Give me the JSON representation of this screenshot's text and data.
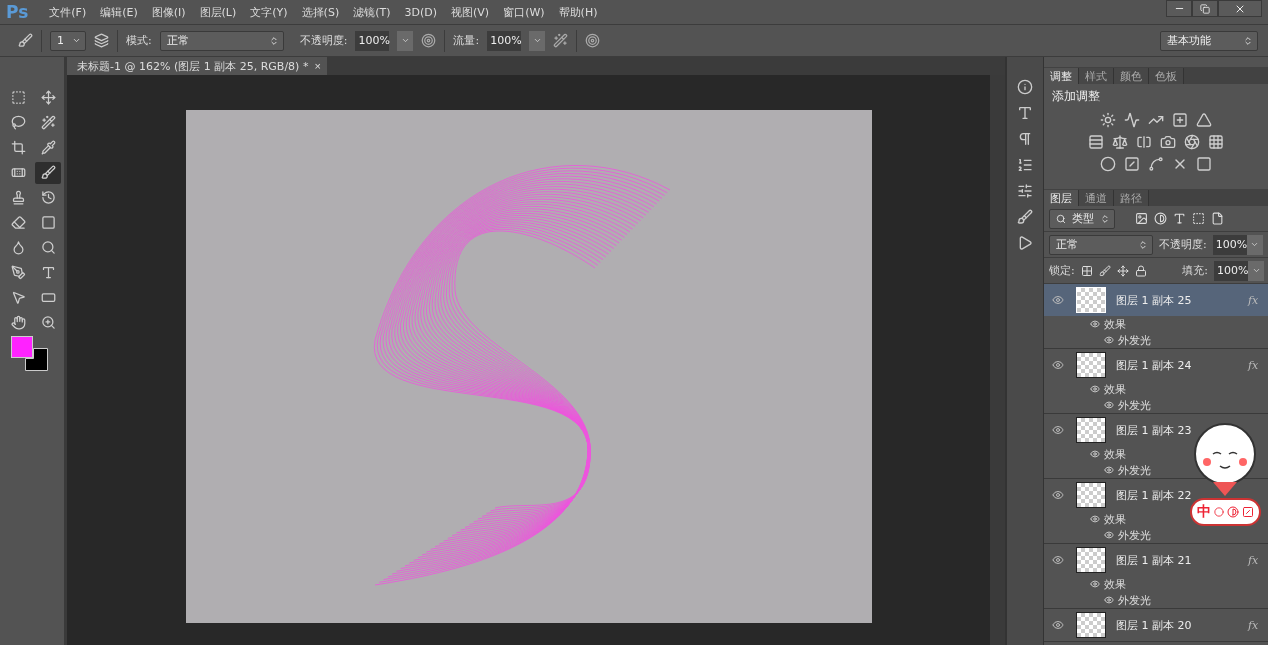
{
  "app": {
    "logo": "Ps"
  },
  "menu": [
    "文件(F)",
    "编辑(E)",
    "图像(I)",
    "图层(L)",
    "文字(Y)",
    "选择(S)",
    "滤镜(T)",
    "3D(D)",
    "视图(V)",
    "窗口(W)",
    "帮助(H)"
  ],
  "options": {
    "brush_size": "1",
    "mode_label": "模式:",
    "mode": "正常",
    "opacity_label": "不透明度:",
    "opacity": "100%",
    "flow_label": "流量:",
    "flow": "100%",
    "workspace": "基本功能"
  },
  "document_tab": {
    "title": "未标题-1 @ 162% (图层 1 副本 25, RGB/8) *",
    "close": "×"
  },
  "tools": [
    {
      "selected": false
    },
    {
      "selected": false
    },
    {
      "selected": false
    },
    {
      "selected": false
    },
    {
      "selected": false
    },
    {
      "selected": false
    },
    {
      "selected": false
    },
    {
      "selected": true
    },
    {
      "selected": false
    },
    {
      "selected": false
    },
    {
      "selected": false
    },
    {
      "selected": false
    },
    {
      "selected": false
    },
    {
      "selected": false
    },
    {
      "selected": false
    },
    {
      "selected": false
    },
    {
      "selected": false
    },
    {
      "selected": false
    },
    {
      "selected": false
    },
    {
      "selected": false
    }
  ],
  "swatches": [
    {
      "color": "#ff22ff"
    },
    {
      "color": "#000000"
    }
  ],
  "adjustments_panel": {
    "tabs": [
      {
        "label": "调整",
        "selected": true
      },
      {
        "label": "样式",
        "selected": false
      },
      {
        "label": "颜色",
        "selected": false
      },
      {
        "label": "色板",
        "selected": false
      }
    ],
    "heading": "添加调整"
  },
  "layers_panel": {
    "tabs": [
      {
        "label": "图层",
        "selected": true
      },
      {
        "label": "通道",
        "selected": false
      },
      {
        "label": "路径",
        "selected": false
      }
    ],
    "filter": "类型",
    "blend_mode": "正常",
    "opacity_label": "不透明度:",
    "opacity": "100%",
    "lock_label": "锁定:",
    "fill_label": "填充:",
    "fill": "100%",
    "layers": [
      {
        "name": "图层 1 副本 25",
        "selected": true,
        "fx": "fx",
        "effects": [
          "效果",
          "外发光"
        ]
      },
      {
        "name": "图层 1 副本 24",
        "selected": false,
        "fx": "fx",
        "effects": [
          "效果",
          "外发光"
        ]
      },
      {
        "name": "图层 1 副本 23",
        "selected": false,
        "effects": [
          "效果",
          "外发光"
        ]
      },
      {
        "name": "图层 1 副本 22",
        "selected": false,
        "effects": [
          "效果",
          "外发光"
        ]
      },
      {
        "name": "图层 1 副本 21",
        "selected": false,
        "fx": "fx",
        "effects": [
          "效果",
          "外发光"
        ]
      },
      {
        "name": "图层 1 副本 20",
        "selected": false,
        "fx": "fx"
      }
    ]
  },
  "ime": {
    "mode": "中"
  }
}
